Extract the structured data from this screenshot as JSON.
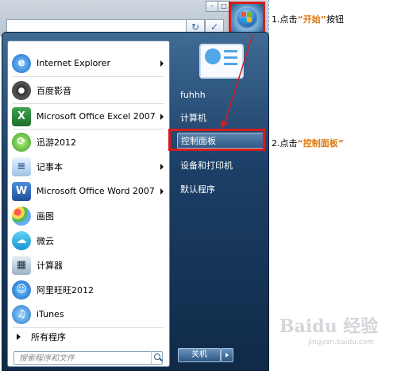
{
  "annotations": {
    "step1_prefix": "1.点击",
    "step1_key": "“开始”",
    "step1_suffix": "按钮",
    "step2_prefix": "2.点击",
    "step2_key": "“控制面板”"
  },
  "start_menu": {
    "programs": [
      {
        "label": "Internet Explorer",
        "icon": "internet-explorer-icon",
        "has_submenu": true
      },
      {
        "label": "百度影音",
        "icon": "film-reel-icon",
        "has_submenu": false
      },
      {
        "label": "Microsoft Office Excel 2007",
        "icon": "excel-icon",
        "has_submenu": true
      },
      {
        "label": "迅游2012",
        "icon": "xunyou-icon",
        "has_submenu": false
      },
      {
        "label": "记事本",
        "icon": "notepad-icon",
        "has_submenu": true
      },
      {
        "label": "Microsoft Office Word 2007",
        "icon": "word-icon",
        "has_submenu": true
      },
      {
        "label": "画图",
        "icon": "paint-icon",
        "has_submenu": false
      },
      {
        "label": "微云",
        "icon": "weiyun-cloud-icon",
        "has_submenu": false
      },
      {
        "label": "计算器",
        "icon": "calculator-icon",
        "has_submenu": false
      },
      {
        "label": "阿里旺旺2012",
        "icon": "aliwangwang-icon",
        "has_submenu": false
      },
      {
        "label": "iTunes",
        "icon": "itunes-icon",
        "has_submenu": false
      }
    ],
    "all_programs": "所有程序",
    "search_placeholder": "搜索程序和文件",
    "right_items": {
      "user": "fuhhh",
      "computer": "计算机",
      "control_panel": "控制面板",
      "devices": "设备和打印机",
      "defaults": "默认程序"
    },
    "shutdown_label": "关机"
  },
  "watermark": {
    "brand": "Baidu 经验",
    "url": "jingyan.baidu.com"
  },
  "colors": {
    "highlight_red": "#d61c1c",
    "annotation_orange": "#e07a10",
    "menu_blue": "#1c3f67"
  }
}
